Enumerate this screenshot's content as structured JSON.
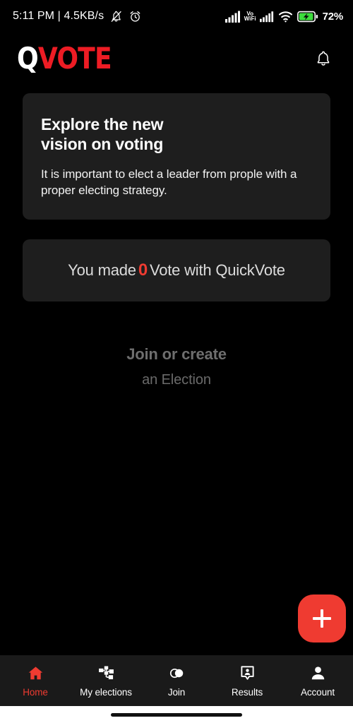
{
  "status_bar": {
    "time": "5:11 PM",
    "separator": "|",
    "network_speed": "4.5KB/s",
    "left_text": "5:11 PM | 4.5KB/s",
    "icons_left": [
      "bell-slash-icon",
      "alarm-clock-icon"
    ],
    "vowifi_line1": "Vo",
    "vowifi_line2": "WiFi",
    "icons_right": [
      "signal-bars-icon",
      "vowifi-label",
      "signal-bars-icon",
      "wifi-icon",
      "battery-charging-icon"
    ],
    "battery_percent": "72%",
    "battery_color": "#3ddc3d"
  },
  "header": {
    "logo_part1": "Q",
    "logo_part2": "VOTE",
    "logo_color_accent": "#ed1c24",
    "notifications_icon": "bell-icon"
  },
  "hero_card": {
    "title": "Explore the new\nvision on voting",
    "body": "It is important to elect a leader from prople with a proper electing strategy."
  },
  "stats_card": {
    "prefix": "You made",
    "count": "0",
    "suffix": "Vote with QuickVote",
    "count_color": "#ef3b31"
  },
  "empty_state": {
    "line1": "Join or create",
    "line2": "an Election"
  },
  "fab": {
    "label": "+",
    "icon": "plus-icon",
    "color": "#ef3b31"
  },
  "bottom_nav": {
    "active_color": "#ef3b31",
    "items": [
      {
        "label": "Home",
        "icon": "home-icon",
        "active": true
      },
      {
        "label": "My elections",
        "icon": "org-chart-icon",
        "active": false
      },
      {
        "label": "Join",
        "icon": "venn-circles-icon",
        "active": false
      },
      {
        "label": "Results",
        "icon": "person-speech-bubble-icon",
        "active": false
      },
      {
        "label": "Account",
        "icon": "person-icon",
        "active": false
      }
    ]
  },
  "system_nav": {
    "gesture_handle": "gesture-pill"
  }
}
